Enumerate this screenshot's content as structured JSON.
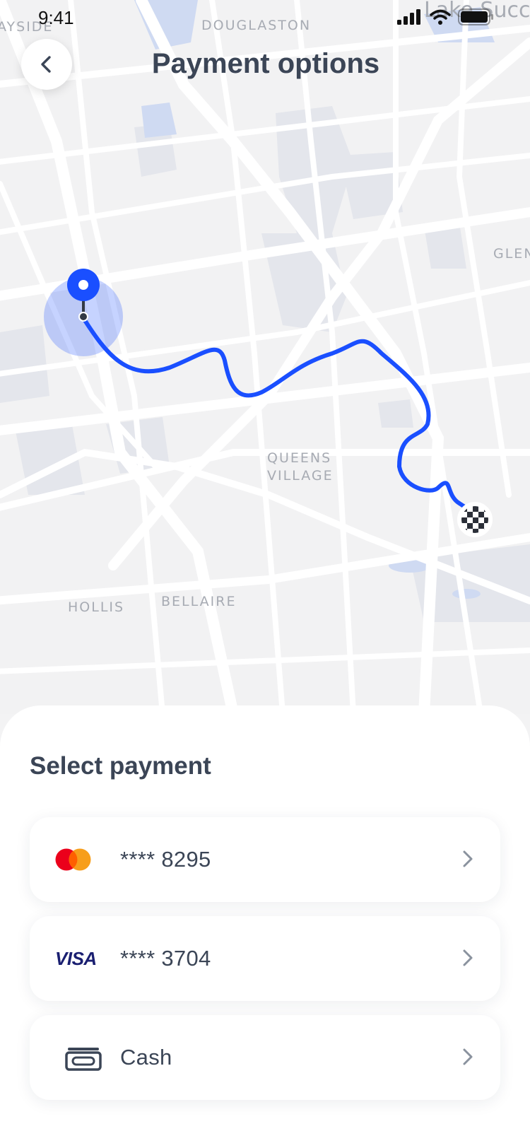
{
  "status_bar": {
    "time": "9:41"
  },
  "header": {
    "title": "Payment options",
    "back_icon": "chevron-left-icon"
  },
  "map": {
    "labels": {
      "bayside": "AYSIDE",
      "douglaston": "DOUGLASTON",
      "lake_success": "Lake Succe",
      "glen": "GLEN",
      "queens_village_1": "QUEENS",
      "queens_village_2": "VILLAGE",
      "hollis": "HOLLIS",
      "bellaire": "BELLAIRE"
    },
    "route_color": "#1a4fff",
    "start_marker": "location-pin-icon",
    "end_marker": "checkered-flag-icon"
  },
  "sheet": {
    "title": "Select payment",
    "methods": [
      {
        "id": "mastercard",
        "icon": "mastercard-icon",
        "label": "**** 8295",
        "chevron": "chevron-right-icon"
      },
      {
        "id": "visa",
        "icon": "visa-icon",
        "brand_text": "VISA",
        "label": "**** 3704",
        "chevron": "chevron-right-icon"
      },
      {
        "id": "cash",
        "icon": "cash-icon",
        "label": "Cash",
        "chevron": "chevron-right-icon"
      }
    ]
  },
  "colors": {
    "accent": "#1a4fff",
    "text": "#3b4556",
    "mastercard_red": "#eb001b",
    "mastercard_orange": "#f79e1b",
    "visa_blue": "#1a1f71"
  }
}
